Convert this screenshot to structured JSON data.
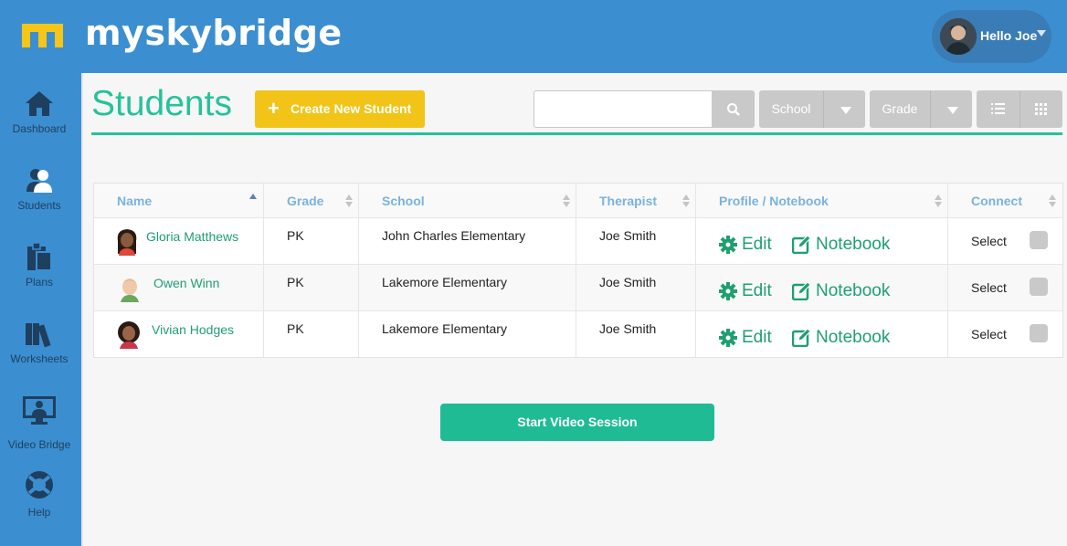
{
  "header": {
    "brand": "myskybridge",
    "greeting": "Hello Joe"
  },
  "sidebar": {
    "items": [
      {
        "label": "Dashboard",
        "icon": "home-icon",
        "active": false
      },
      {
        "label": "Students",
        "icon": "students-icon",
        "active": true
      },
      {
        "label": "Plans",
        "icon": "clipboard-icon",
        "active": false
      },
      {
        "label": "Worksheets",
        "icon": "books-icon",
        "active": false
      },
      {
        "label": "Video Bridge",
        "icon": "monitor-icon",
        "active": false
      },
      {
        "label": "Help",
        "icon": "lifebuoy-icon",
        "active": false
      }
    ]
  },
  "main": {
    "title": "Students",
    "create_button": "Create New Student",
    "search": {
      "value": "",
      "placeholder": ""
    },
    "filters": {
      "school": "School",
      "grade": "Grade"
    }
  },
  "table": {
    "columns": [
      "Name",
      "Grade",
      "School",
      "Therapist",
      "Profile / Notebook",
      "Connect"
    ],
    "rows": [
      {
        "name": "Gloria Matthews",
        "grade": "PK",
        "school": "John Charles Elementary",
        "therapist": "Joe Smith",
        "edit": "Edit",
        "notebook": "Notebook",
        "select": "Select"
      },
      {
        "name": "Owen Winn",
        "grade": "PK",
        "school": "Lakemore Elementary",
        "therapist": "Joe Smith",
        "edit": "Edit",
        "notebook": "Notebook",
        "select": "Select"
      },
      {
        "name": "Vivian Hodges",
        "grade": "PK",
        "school": "Lakemore Elementary",
        "therapist": "Joe Smith",
        "edit": "Edit",
        "notebook": "Notebook",
        "select": "Select"
      }
    ]
  },
  "actions": {
    "start_video": "Start Video Session"
  },
  "colors": {
    "primary_blue": "#3b8fd0",
    "accent_green": "#26c29a",
    "link_green": "#1f9f72",
    "yellow": "#f2c417",
    "header_text": "#7ab3de"
  }
}
